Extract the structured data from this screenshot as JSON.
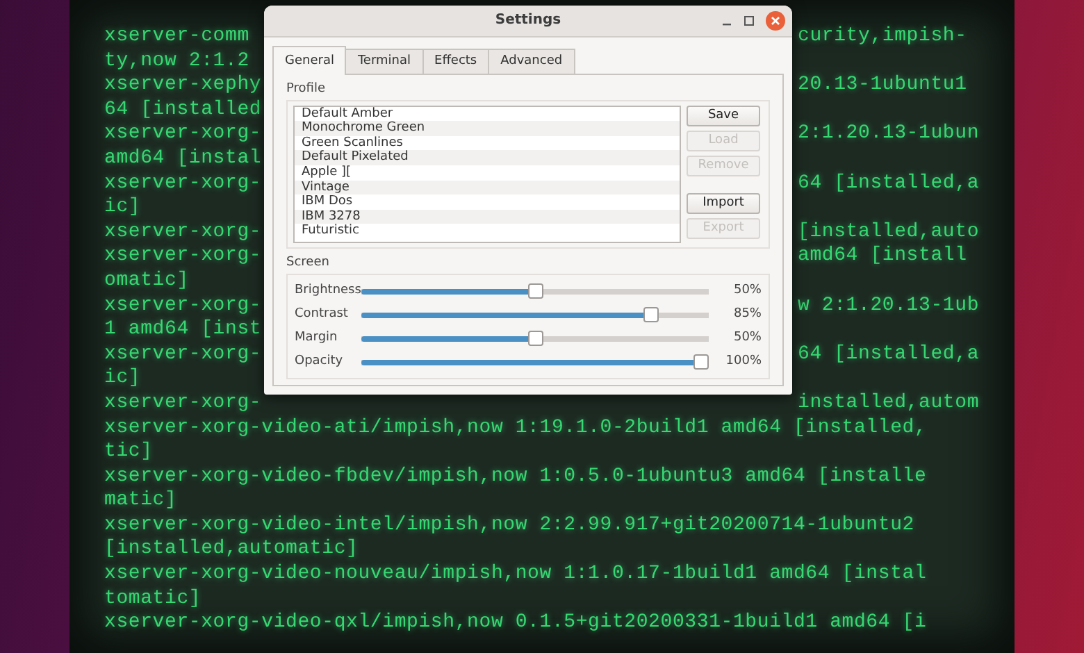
{
  "terminal": {
    "lines": [
      {
        "kind": "split",
        "left": "xserver-comm",
        "right": "curity,impish-"
      },
      {
        "kind": "split",
        "left": "ty,now 2:1.2"
      },
      {
        "kind": "split",
        "left": "xserver-xephy",
        "right": "20.13-1ubuntu1"
      },
      {
        "kind": "split",
        "left": "64 [installed"
      },
      {
        "kind": "split",
        "left": "xserver-xorg-",
        "right": "2:1.20.13-1ubun"
      },
      {
        "kind": "split",
        "left": "amd64 [instal"
      },
      {
        "kind": "split",
        "left": "xserver-xorg-",
        "right": "64 [installed,a"
      },
      {
        "kind": "split",
        "left": "ic]"
      },
      {
        "kind": "split",
        "left": "xserver-xorg-",
        "right": "[installed,auto"
      },
      {
        "kind": "split",
        "left": "xserver-xorg-",
        "right": "amd64 [install"
      },
      {
        "kind": "split",
        "left": "omatic]"
      },
      {
        "kind": "split",
        "left": "xserver-xorg-",
        "right": "w 2:1.20.13-1ub"
      },
      {
        "kind": "split",
        "left": "1 amd64 [inst"
      },
      {
        "kind": "split",
        "left": "xserver-xorg-",
        "right": "64 [installed,a"
      },
      {
        "kind": "split",
        "left": "ic]"
      },
      {
        "kind": "split",
        "left": "xserver-xorg-",
        "right": "installed,autom"
      },
      {
        "kind": "full",
        "text": "xserver-xorg-video-ati/impish,now 1:19.1.0-2build1 amd64 [installed,"
      },
      {
        "kind": "full",
        "text": "tic]"
      },
      {
        "kind": "full",
        "text": "xserver-xorg-video-fbdev/impish,now 1:0.5.0-1ubuntu3 amd64 [installe"
      },
      {
        "kind": "full",
        "text": "matic]"
      },
      {
        "kind": "full",
        "text": "xserver-xorg-video-intel/impish,now 2:2.99.917+git20200714-1ubuntu2"
      },
      {
        "kind": "full",
        "text": "[installed,automatic]"
      },
      {
        "kind": "full",
        "text": "xserver-xorg-video-nouveau/impish,now 1:1.0.17-1build1 amd64 [instal"
      },
      {
        "kind": "full",
        "text": "tomatic]"
      },
      {
        "kind": "full",
        "text": "xserver-xorg-video-qxl/impish,now 0.1.5+git20200331-1build1 amd64 [i"
      }
    ]
  },
  "dialog": {
    "title": "Settings",
    "tabs": [
      {
        "label": "General",
        "selected": true
      },
      {
        "label": "Terminal",
        "selected": false
      },
      {
        "label": "Effects",
        "selected": false
      },
      {
        "label": "Advanced",
        "selected": false
      }
    ],
    "profile": {
      "label": "Profile",
      "items": [
        {
          "label": "Default Amber",
          "selected": false
        },
        {
          "label": "Monochrome Green",
          "selected": false
        },
        {
          "label": "Green Scanlines",
          "selected": false
        },
        {
          "label": "Default Pixelated",
          "selected": false
        },
        {
          "label": "Apple ][",
          "selected": false
        },
        {
          "label": "Vintage",
          "selected": false
        },
        {
          "label": "IBM Dos",
          "selected": false
        },
        {
          "label": "IBM 3278",
          "selected": false
        },
        {
          "label": "Futuristic",
          "selected": false
        }
      ],
      "button_groups": [
        [
          {
            "label": "Save",
            "disabled": false
          },
          {
            "label": "Load",
            "disabled": true
          },
          {
            "label": "Remove",
            "disabled": true
          }
        ],
        [
          {
            "label": "Import",
            "disabled": false
          },
          {
            "label": "Export",
            "disabled": true
          }
        ]
      ]
    },
    "screen": {
      "label": "Screen",
      "sliders": [
        {
          "label": "Brightness",
          "level": 0.5,
          "reading": "50%"
        },
        {
          "label": "Contrast",
          "level": 0.85,
          "reading": "85%"
        },
        {
          "label": "Margin",
          "level": 0.5,
          "reading": "50%"
        },
        {
          "label": "Opacity",
          "level": 1.0,
          "reading": "100%"
        }
      ]
    }
  }
}
